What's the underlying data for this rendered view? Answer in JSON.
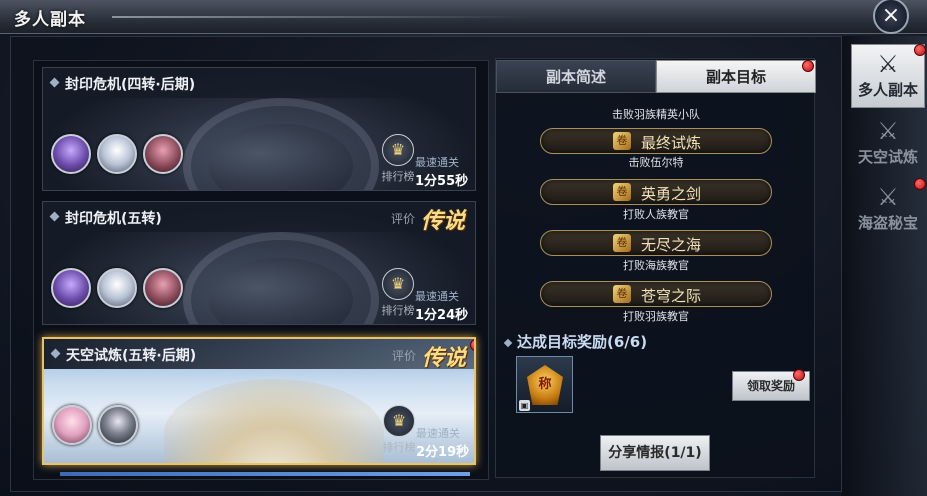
{
  "window": {
    "title": "多人副本",
    "close_icon": "×"
  },
  "dungeons": [
    {
      "name": "封印危机(四转·后期)",
      "rating_label": "",
      "grade": "",
      "fastest_label": "最速通关",
      "time": "1分55秒",
      "rank_label": "排行榜"
    },
    {
      "name": "封印危机(五转)",
      "rating_label": "评价",
      "grade": "传说",
      "fastest_label": "最速通关",
      "time": "1分24秒",
      "rank_label": "排行榜"
    },
    {
      "name": "天空试炼(五转·后期)",
      "rating_label": "评价",
      "grade": "传说",
      "fastest_label": "最速通关",
      "time": "2分19秒",
      "rank_label": "排行榜"
    }
  ],
  "tabs": {
    "overview": "副本简述",
    "objectives": "副本目标"
  },
  "objectives": {
    "partial_sub": "击败羽族精英小队",
    "items": [
      {
        "title": "最终试炼",
        "desc": "击败伍尔特"
      },
      {
        "title": "英勇之剑",
        "desc": "打败人族教官"
      },
      {
        "title": "无尽之海",
        "desc": "打败海族教官"
      },
      {
        "title": "苍穹之际",
        "desc": "打败羽族教官"
      }
    ]
  },
  "rewards": {
    "title": "达成目标奖励(6/6)",
    "item_glyph": "称",
    "claim_label": "领取奖励"
  },
  "share_label": "分享情报(1/1)",
  "side_tabs": [
    {
      "label": "多人副本",
      "icon": "crossed-swords-icon"
    },
    {
      "label": "天空试炼",
      "icon": "crossed-swords-icon"
    },
    {
      "label": "海盗秘宝",
      "icon": "crossed-swords-icon"
    }
  ],
  "colors": {
    "legend_gold": "#f7dc8a",
    "selected_border": "#e8c36a",
    "red_dot": "#d41515"
  }
}
